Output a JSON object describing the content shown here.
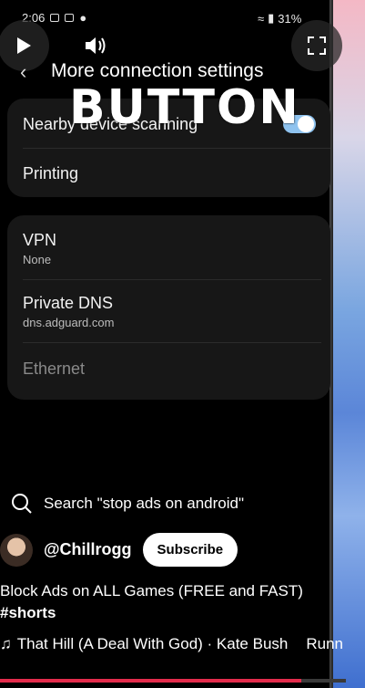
{
  "status_bar": {
    "time": "2:06",
    "battery": "31%"
  },
  "overlay": {
    "label": "BUTTON"
  },
  "header": {
    "title": "More connection settings"
  },
  "card1": {
    "nearby_label": "Nearby device scanning",
    "nearby_enabled": true,
    "printing_label": "Printing"
  },
  "card2": {
    "vpn_label": "VPN",
    "vpn_value": "None",
    "dns_label": "Private DNS",
    "dns_value": "dns.adguard.com",
    "ethernet_label": "Ethernet"
  },
  "search": {
    "query": "Search \"stop ads on android\""
  },
  "channel": {
    "name": "@Chillrogg",
    "subscribe_label": "Subscribe"
  },
  "video": {
    "title": "Block Ads on ALL Games (FREE and FAST)",
    "hashtag": "#shorts"
  },
  "music": {
    "track": "That Hill (A Deal With God) · Kate Bush",
    "next": "Runn"
  },
  "playback": {
    "progress_fraction": 0.87
  },
  "colors": {
    "toggle": "#8fc3ef",
    "progress": "#e32c4c"
  }
}
